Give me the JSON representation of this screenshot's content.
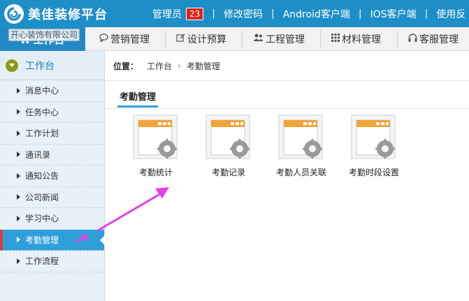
{
  "header": {
    "title": "美佳装修平台",
    "links": [
      {
        "label": "管理员"
      },
      {
        "label": "修改密码"
      },
      {
        "label": "Android客户端"
      },
      {
        "label": "IOS客户端"
      },
      {
        "label": "使用反"
      }
    ],
    "badge_count": "23"
  },
  "nav": {
    "home_label": "工作台",
    "watermark": "开心装饰有限公司",
    "items": [
      {
        "label": "营销管理",
        "icon": "chat-icon"
      },
      {
        "label": "设计预算",
        "icon": "edit-icon"
      },
      {
        "label": "工程管理",
        "icon": "users-icon"
      },
      {
        "label": "材料管理",
        "icon": "grid-icon"
      },
      {
        "label": "客服管理",
        "icon": "headset-icon"
      }
    ]
  },
  "sidebar": {
    "header": "工作台",
    "items": [
      {
        "label": "消息中心"
      },
      {
        "label": "任务中心"
      },
      {
        "label": "工作计划"
      },
      {
        "label": "通讯录"
      },
      {
        "label": "通知公告"
      },
      {
        "label": "公司新闻"
      },
      {
        "label": "学习中心"
      },
      {
        "label": "考勤管理",
        "active": true
      },
      {
        "label": "工作流程"
      }
    ]
  },
  "breadcrumb": {
    "label": "位置：",
    "path": [
      "工作台",
      "考勤管理"
    ]
  },
  "main": {
    "section_title": "考勤管理",
    "tiles": [
      {
        "label": "考勤统计"
      },
      {
        "label": "考勤记录"
      },
      {
        "label": "考勤人员关联"
      },
      {
        "label": "考勤时段设置"
      }
    ]
  },
  "colors": {
    "header_bg": "#1e8fc6",
    "active_bg": "#2f9fda",
    "arrow": "#e83de8"
  }
}
